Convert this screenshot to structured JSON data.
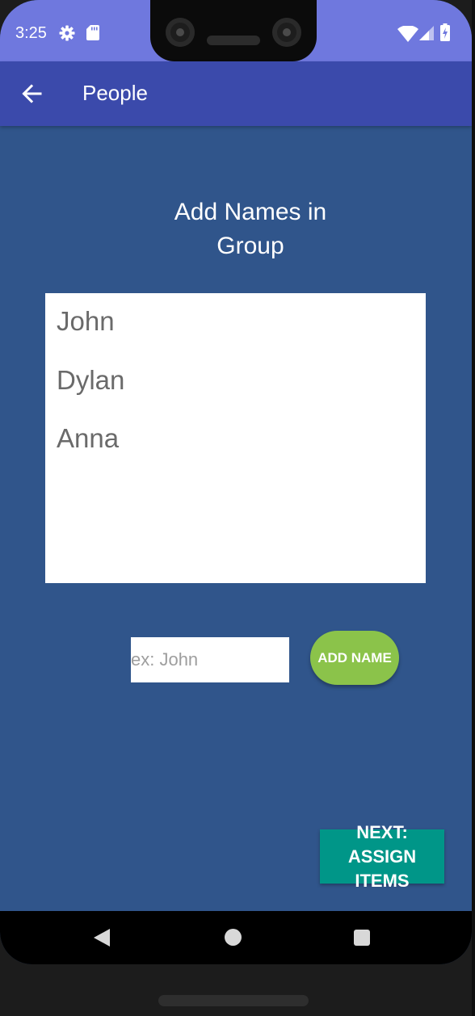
{
  "status_bar": {
    "time": "3:25",
    "left_icons": [
      "gear-icon",
      "sd-card-icon"
    ],
    "right_icons": [
      "wifi-icon",
      "cellular-signal-icon",
      "battery-charging-icon"
    ]
  },
  "app_bar": {
    "back_icon": "arrow-left-icon",
    "title": "People"
  },
  "main": {
    "heading": "Add Names in Group",
    "names": [
      "John",
      "Dylan",
      "Anna"
    ],
    "name_input": {
      "value": "",
      "placeholder": "ex: John"
    },
    "add_button_label": "ADD NAME",
    "next_button_label": "NEXT: ASSIGN ITEMS"
  },
  "nav_bar": {
    "icons": [
      "back-triangle-icon",
      "home-circle-icon",
      "recents-square-icon"
    ]
  },
  "colors": {
    "status_bar": "#6f78de",
    "app_bar": "#3b4aab",
    "background": "#30558b",
    "add_button": "#8bc34a",
    "next_button": "#009688"
  }
}
